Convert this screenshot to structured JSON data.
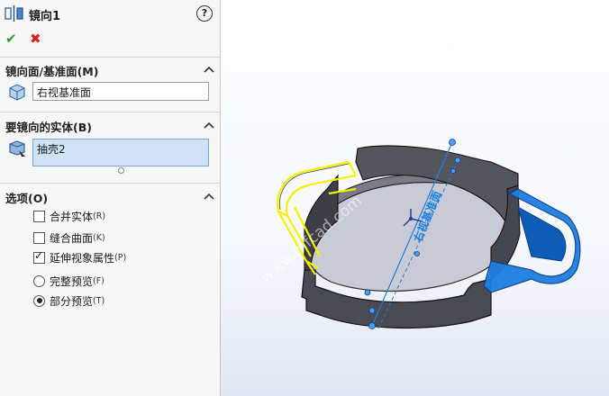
{
  "feature": {
    "title": "镜向1",
    "help_label": "?",
    "ok_icon": "checkmark-icon",
    "cancel_icon": "x-icon"
  },
  "sections": {
    "mirror_face": {
      "title": "镜向面/基准面(M)",
      "value": "右视基准面"
    },
    "bodies": {
      "title": "要镜向的实体(B)",
      "value": "抽壳2"
    },
    "options": {
      "title": "选项(O)",
      "merge": {
        "label": "合并实体",
        "key": "(R)",
        "checked": false
      },
      "knit": {
        "label": "缝合曲面",
        "key": "(K)",
        "checked": false
      },
      "propagate": {
        "label": "延伸视象属性",
        "key": "(P)",
        "checked": true
      },
      "full_preview": {
        "label": "完整预览",
        "key": "(F)",
        "selected": false
      },
      "partial_preview": {
        "label": "部分预览",
        "key": "(T)",
        "selected": true
      }
    }
  },
  "viewport": {
    "plane_label": "右视基准面",
    "watermark": "www.mfcad.com"
  },
  "colors": {
    "accent_blue": "#1e7fe0",
    "preview_yellow": "#f2f200",
    "ok_green": "#2a9a2a",
    "cancel_red": "#d42020",
    "body_gray": "#4a4a52",
    "floor_gray": "#c9cad6"
  }
}
